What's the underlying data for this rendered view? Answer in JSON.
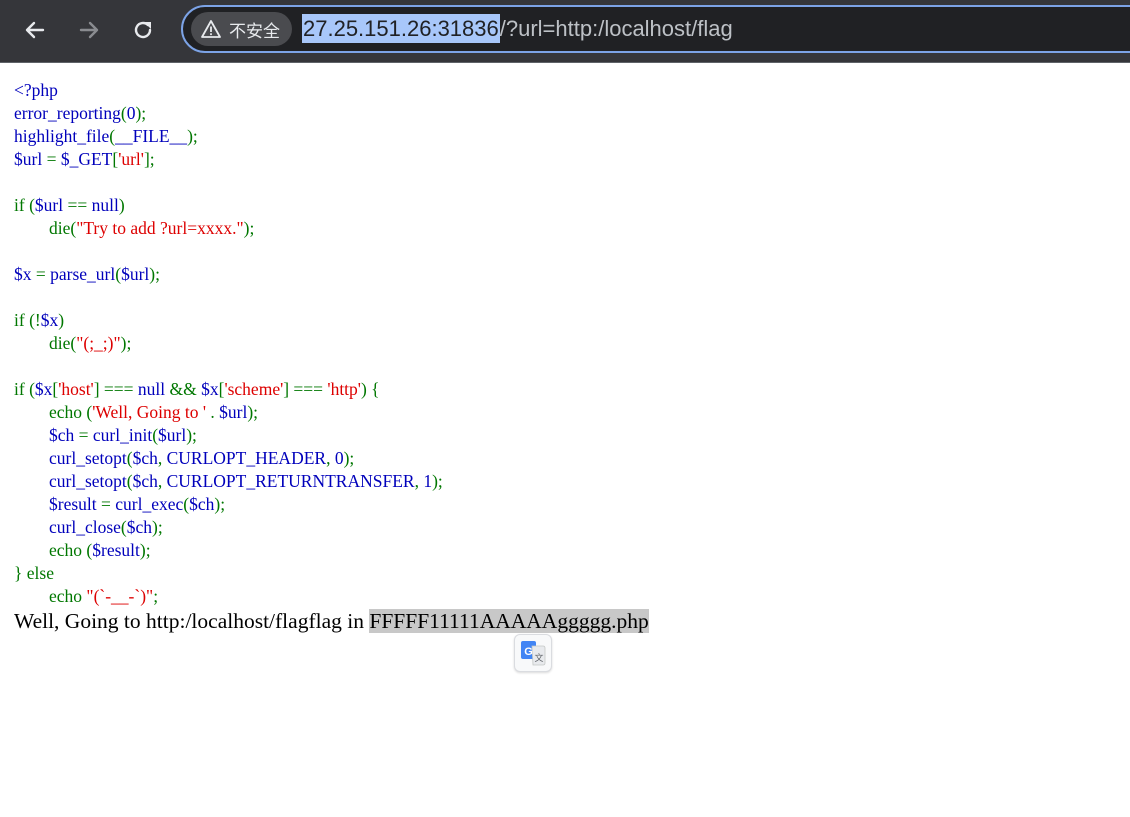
{
  "browser": {
    "security_chip_label": "不安全",
    "url_host": "27.25.151.26:31836",
    "url_rest": "/?url=http:/localhost/flag"
  },
  "source_lines": [
    [
      {
        "t": "<?php",
        "c": "df"
      }
    ],
    [
      {
        "t": "error_reporting",
        "c": "df"
      },
      {
        "t": "(",
        "c": "kw"
      },
      {
        "t": "0",
        "c": "df"
      },
      {
        "t": ");",
        "c": "kw"
      }
    ],
    [
      {
        "t": "highlight_file",
        "c": "df"
      },
      {
        "t": "(",
        "c": "kw"
      },
      {
        "t": "__FILE__",
        "c": "df"
      },
      {
        "t": ");",
        "c": "kw"
      }
    ],
    [
      {
        "t": "$url ",
        "c": "df"
      },
      {
        "t": "= ",
        "c": "kw"
      },
      {
        "t": "$_GET",
        "c": "df"
      },
      {
        "t": "[",
        "c": "kw"
      },
      {
        "t": "'url'",
        "c": "st"
      },
      {
        "t": "];",
        "c": "kw"
      }
    ],
    [],
    [
      {
        "t": "if ",
        "c": "kw"
      },
      {
        "t": "(",
        "c": "kw"
      },
      {
        "t": "$url ",
        "c": "df"
      },
      {
        "t": "== ",
        "c": "kw"
      },
      {
        "t": "null",
        "c": "df"
      },
      {
        "t": ")",
        "c": "kw"
      }
    ],
    [
      {
        "t": "        die",
        "c": "kw"
      },
      {
        "t": "(",
        "c": "kw"
      },
      {
        "t": "\"Try to add ?url=xxxx.\"",
        "c": "st"
      },
      {
        "t": ");",
        "c": "kw"
      }
    ],
    [],
    [
      {
        "t": "$x ",
        "c": "df"
      },
      {
        "t": "= ",
        "c": "kw"
      },
      {
        "t": "parse_url",
        "c": "df"
      },
      {
        "t": "(",
        "c": "kw"
      },
      {
        "t": "$url",
        "c": "df"
      },
      {
        "t": ");",
        "c": "kw"
      }
    ],
    [],
    [
      {
        "t": "if ",
        "c": "kw"
      },
      {
        "t": "(!",
        "c": "kw"
      },
      {
        "t": "$x",
        "c": "df"
      },
      {
        "t": ")",
        "c": "kw"
      }
    ],
    [
      {
        "t": "        die",
        "c": "kw"
      },
      {
        "t": "(",
        "c": "kw"
      },
      {
        "t": "\"(;_;)\"",
        "c": "st"
      },
      {
        "t": ");",
        "c": "kw"
      }
    ],
    [],
    [
      {
        "t": "if ",
        "c": "kw"
      },
      {
        "t": "(",
        "c": "kw"
      },
      {
        "t": "$x",
        "c": "df"
      },
      {
        "t": "[",
        "c": "kw"
      },
      {
        "t": "'host'",
        "c": "st"
      },
      {
        "t": "] === ",
        "c": "kw"
      },
      {
        "t": "null ",
        "c": "df"
      },
      {
        "t": "&& ",
        "c": "kw"
      },
      {
        "t": "$x",
        "c": "df"
      },
      {
        "t": "[",
        "c": "kw"
      },
      {
        "t": "'scheme'",
        "c": "st"
      },
      {
        "t": "] === ",
        "c": "kw"
      },
      {
        "t": "'http'",
        "c": "st"
      },
      {
        "t": ") {",
        "c": "kw"
      }
    ],
    [
      {
        "t": "        echo ",
        "c": "kw"
      },
      {
        "t": "(",
        "c": "kw"
      },
      {
        "t": "'Well, Going to ' ",
        "c": "st"
      },
      {
        "t": ". ",
        "c": "kw"
      },
      {
        "t": "$url",
        "c": "df"
      },
      {
        "t": ");",
        "c": "kw"
      }
    ],
    [
      {
        "t": "        $ch ",
        "c": "df"
      },
      {
        "t": "= ",
        "c": "kw"
      },
      {
        "t": "curl_init",
        "c": "df"
      },
      {
        "t": "(",
        "c": "kw"
      },
      {
        "t": "$url",
        "c": "df"
      },
      {
        "t": ");",
        "c": "kw"
      }
    ],
    [
      {
        "t": "        curl_setopt",
        "c": "df"
      },
      {
        "t": "(",
        "c": "kw"
      },
      {
        "t": "$ch",
        "c": "df"
      },
      {
        "t": ", ",
        "c": "kw"
      },
      {
        "t": "CURLOPT_HEADER",
        "c": "df"
      },
      {
        "t": ", ",
        "c": "kw"
      },
      {
        "t": "0",
        "c": "df"
      },
      {
        "t": ");",
        "c": "kw"
      }
    ],
    [
      {
        "t": "        curl_setopt",
        "c": "df"
      },
      {
        "t": "(",
        "c": "kw"
      },
      {
        "t": "$ch",
        "c": "df"
      },
      {
        "t": ", ",
        "c": "kw"
      },
      {
        "t": "CURLOPT_RETURNTRANSFER",
        "c": "df"
      },
      {
        "t": ", ",
        "c": "kw"
      },
      {
        "t": "1",
        "c": "df"
      },
      {
        "t": ");",
        "c": "kw"
      }
    ],
    [
      {
        "t": "        $result ",
        "c": "df"
      },
      {
        "t": "= ",
        "c": "kw"
      },
      {
        "t": "curl_exec",
        "c": "df"
      },
      {
        "t": "(",
        "c": "kw"
      },
      {
        "t": "$ch",
        "c": "df"
      },
      {
        "t": ");",
        "c": "kw"
      }
    ],
    [
      {
        "t": "        curl_close",
        "c": "df"
      },
      {
        "t": "(",
        "c": "kw"
      },
      {
        "t": "$ch",
        "c": "df"
      },
      {
        "t": ");",
        "c": "kw"
      }
    ],
    [
      {
        "t": "        echo ",
        "c": "kw"
      },
      {
        "t": "(",
        "c": "kw"
      },
      {
        "t": "$result",
        "c": "df"
      },
      {
        "t": ");",
        "c": "kw"
      }
    ],
    [
      {
        "t": "} else",
        "c": "kw"
      }
    ],
    [
      {
        "t": "        echo ",
        "c": "kw"
      },
      {
        "t": "\"(`-__-`)\"",
        "c": "st"
      },
      {
        "t": ";",
        "c": "kw"
      }
    ]
  ],
  "output": {
    "text": "Well, Going to http:/localhost/flagflag in ",
    "highlighted": "FFFFF11111AAAAAggggg.php"
  },
  "colors": {
    "keyword": "#007700",
    "default": "#0000bb",
    "string": "#dd0000"
  }
}
